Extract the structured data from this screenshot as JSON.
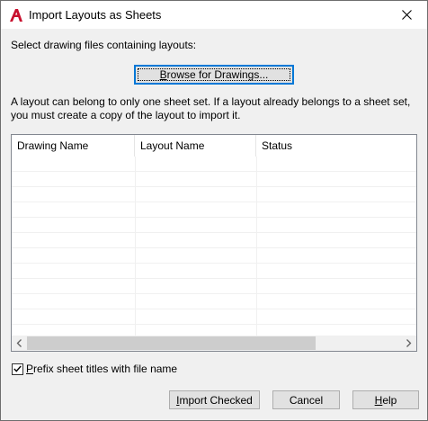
{
  "window": {
    "title": "Import Layouts as Sheets",
    "app_icon": "autocad-a-icon",
    "close_icon": "close-x-icon"
  },
  "labels": {
    "select_files": "Select drawing files containing layouts:",
    "info": "A layout can belong to only one sheet set. If a layout already belongs to a sheet set, you must create a copy of the layout to import it."
  },
  "buttons": {
    "browse": {
      "accel": "B",
      "rest": "rowse for Drawings..."
    },
    "import_checked": {
      "accel": "I",
      "rest": "mport Checked"
    },
    "cancel": "Cancel",
    "help": {
      "accel": "H",
      "rest": "elp"
    }
  },
  "table": {
    "columns": [
      "Drawing Name",
      "Layout Name",
      "Status"
    ],
    "rows": []
  },
  "prefix_option": {
    "checked": true,
    "accel": "P",
    "rest": "refix sheet titles with file name"
  },
  "colors": {
    "accent": "#0078d7",
    "autocad_red": "#c8102e"
  }
}
